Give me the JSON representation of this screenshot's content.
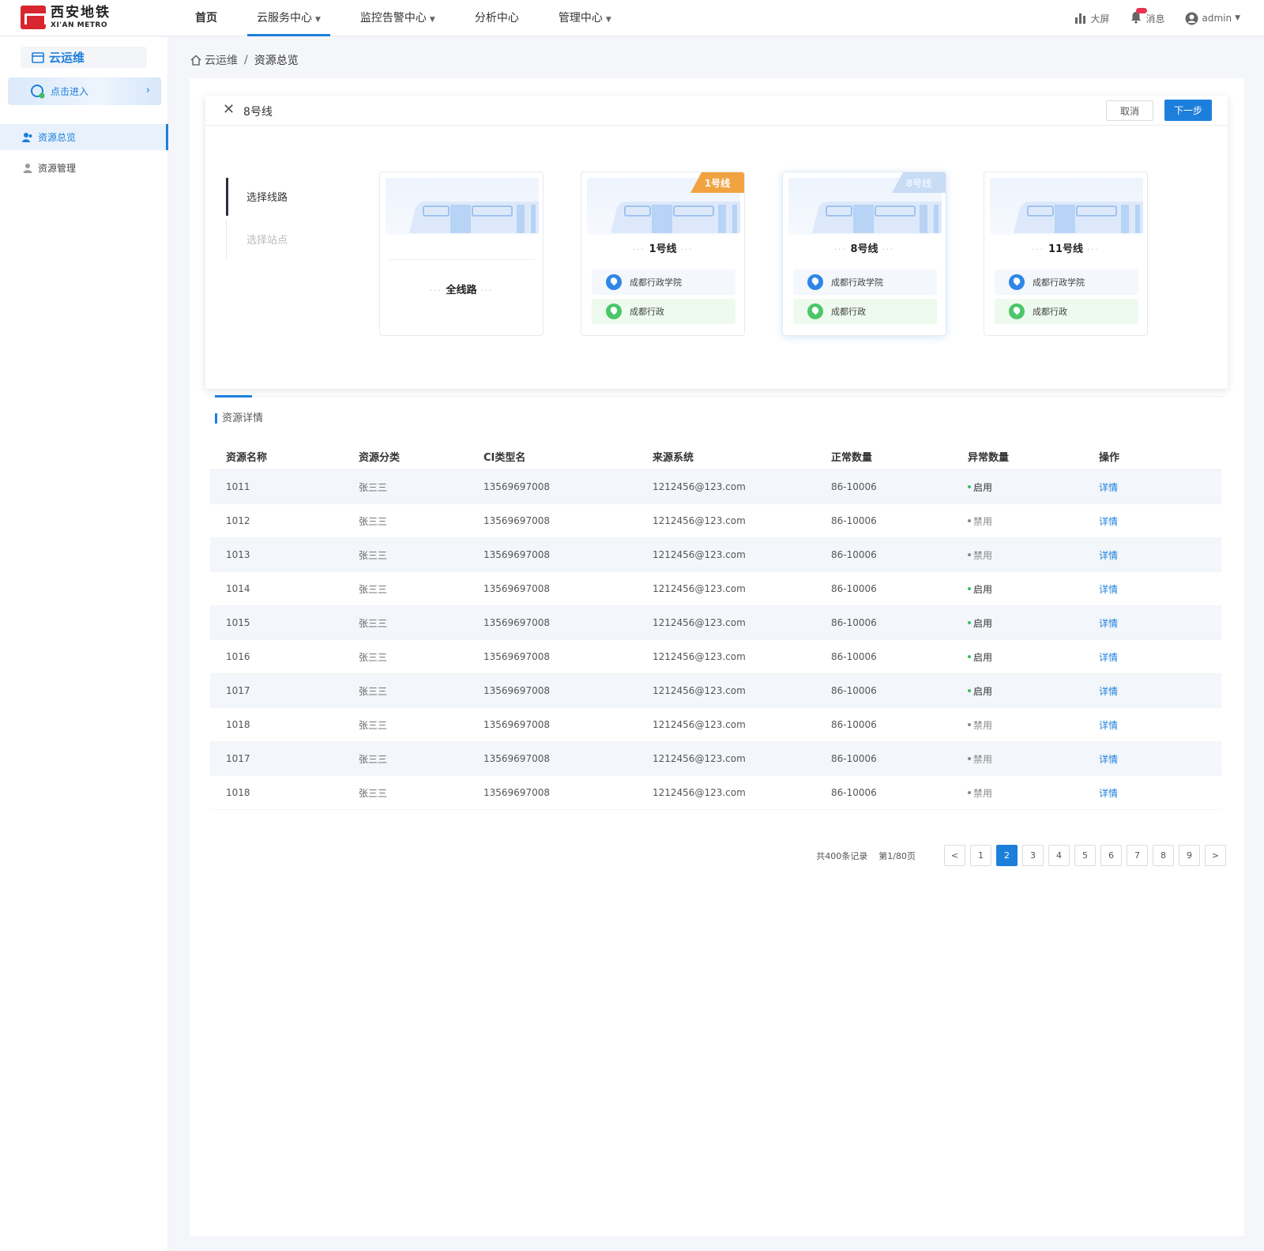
{
  "brand": {
    "cn": "西安地铁",
    "en": "XI'AN METRO"
  },
  "nav": {
    "items": [
      {
        "label": "首页",
        "dropdown": false,
        "active": false
      },
      {
        "label": "云服务中心",
        "dropdown": true,
        "active": true
      },
      {
        "label": "监控告警中心",
        "dropdown": true,
        "active": false
      },
      {
        "label": "分析中心",
        "dropdown": false,
        "active": false
      },
      {
        "label": "管理中心",
        "dropdown": true,
        "active": false
      }
    ],
    "tools": {
      "screen": "大屏",
      "messages": "消息",
      "user": "admin"
    }
  },
  "sidebar": {
    "title": "云运维",
    "enter": "点击进入",
    "items": [
      {
        "label": "资源总览",
        "active": true
      },
      {
        "label": "资源管理",
        "active": false
      }
    ]
  },
  "breadcrumb": {
    "home": "云运维",
    "current": "资源总览"
  },
  "panel": {
    "title": "8号线",
    "cancel": "取消",
    "next": "下一步",
    "steps": [
      "选择线路",
      "选择站点"
    ],
    "lines": [
      {
        "name": "全线路",
        "tag": "",
        "stations": []
      },
      {
        "name": "1号线",
        "tag": "1号线",
        "stations": [
          "成都行政学院",
          "成都行政"
        ]
      },
      {
        "name": "8号线",
        "tag": "8号线",
        "stations": [
          "成都行政学院",
          "成都行政"
        ]
      },
      {
        "name": "11号线",
        "tag": "",
        "stations": [
          "成都行政学院",
          "成都行政"
        ]
      }
    ]
  },
  "section_title": "资源详情",
  "table": {
    "headers": [
      "资源名称",
      "资源分类",
      "CI类型名",
      "来源系统",
      "正常数量",
      "异常数量",
      "操作"
    ],
    "rows": [
      [
        "1011",
        "张三三",
        "13569697008",
        "1212456@123.com",
        "86-10006",
        "启用",
        "详情"
      ],
      [
        "1012",
        "张三三",
        "13569697008",
        "1212456@123.com",
        "86-10006",
        "禁用",
        "详情"
      ],
      [
        "1013",
        "张三三",
        "13569697008",
        "1212456@123.com",
        "86-10006",
        "禁用",
        "详情"
      ],
      [
        "1014",
        "张三三",
        "13569697008",
        "1212456@123.com",
        "86-10006",
        "启用",
        "详情"
      ],
      [
        "1015",
        "张三三",
        "13569697008",
        "1212456@123.com",
        "86-10006",
        "启用",
        "详情"
      ],
      [
        "1016",
        "张三三",
        "13569697008",
        "1212456@123.com",
        "86-10006",
        "启用",
        "详情"
      ],
      [
        "1017",
        "张三三",
        "13569697008",
        "1212456@123.com",
        "86-10006",
        "启用",
        "详情"
      ],
      [
        "1018",
        "张三三",
        "13569697008",
        "1212456@123.com",
        "86-10006",
        "禁用",
        "详情"
      ],
      [
        "1017",
        "张三三",
        "13569697008",
        "1212456@123.com",
        "86-10006",
        "禁用",
        "详情"
      ],
      [
        "1018",
        "张三三",
        "13569697008",
        "1212456@123.com",
        "86-10006",
        "禁用",
        "详情"
      ]
    ]
  },
  "pagination": {
    "total": "共400条记录",
    "page_info": "第1/80页",
    "pages": [
      "1",
      "2",
      "3",
      "4",
      "5",
      "6",
      "7",
      "8",
      "9"
    ],
    "current": "2",
    "prev": "<",
    "next": ">"
  },
  "colors": {
    "accent": "#1d7fdc",
    "tag_orange": "#f2a341",
    "enabled": "#3bbf5f",
    "brand_red": "#d7262f"
  }
}
